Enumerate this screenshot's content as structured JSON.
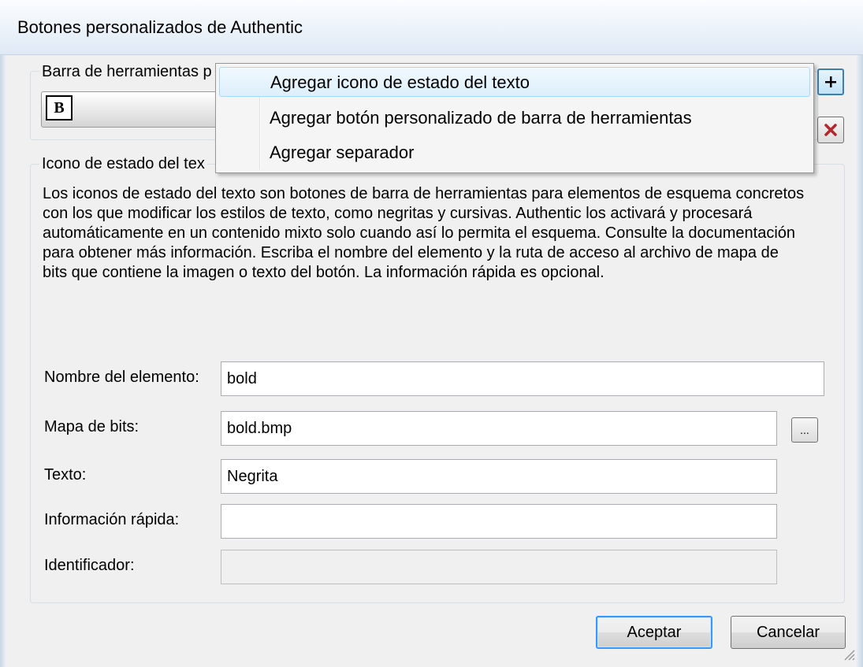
{
  "window": {
    "title": "Botones personalizados de Authentic"
  },
  "toolbar_group": {
    "label": "Barra de herramientas p",
    "bold_button_text": "B"
  },
  "side_buttons": {
    "add_icon": "plus-icon",
    "delete_icon": "delete-x-icon",
    "delete_color": "#c0282c"
  },
  "menu": {
    "items": [
      {
        "label": "Agregar icono de estado del texto"
      },
      {
        "label": "Agregar botón personalizado de barra de herramientas"
      },
      {
        "label": "Agregar separador"
      }
    ]
  },
  "details_group": {
    "label": "Icono de estado del tex",
    "description": "Los iconos de estado del texto son botones de barra de herramientas para elementos de esquema concretos con los que modificar los estilos de texto, como negritas y cursivas. Authentic los activará y procesará automáticamente en un contenido mixto solo cuando así lo permita el esquema. Consulte la documentación para obtener más información. Escriba el nombre del elemento y la ruta de acceso al archivo de mapa de bits que contiene la imagen o texto del botón. La información rápida es opcional."
  },
  "fields": {
    "element_name": {
      "label": "Nombre del elemento:",
      "value": "bold"
    },
    "bitmap": {
      "label": "Mapa de bits:",
      "value": "bold.bmp",
      "browse_label": "..."
    },
    "text": {
      "label": "Texto:",
      "value": "Negrita"
    },
    "tooltip": {
      "label": "Información rápida:",
      "value": ""
    },
    "identifier": {
      "label": "Identificador:",
      "value": ""
    }
  },
  "buttons": {
    "ok": "Aceptar",
    "cancel": "Cancelar"
  }
}
